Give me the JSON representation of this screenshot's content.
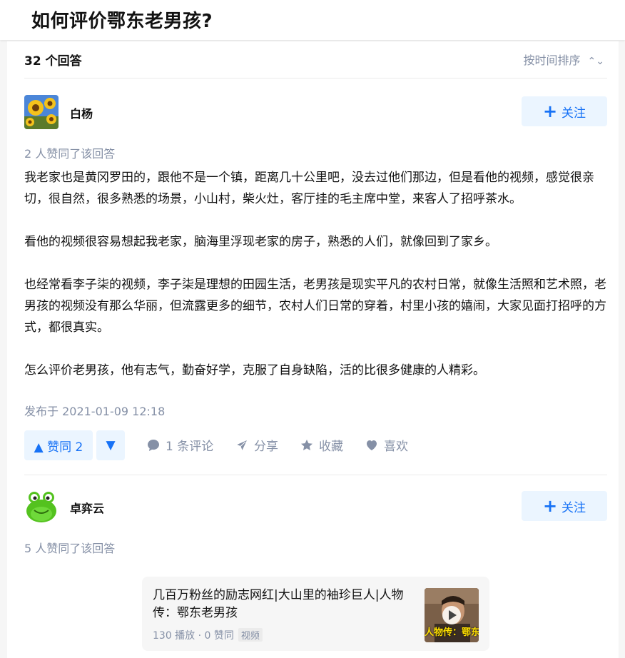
{
  "question": {
    "title": "如何评价鄂东老男孩?"
  },
  "answers_header": {
    "count_label": "32 个回答",
    "sort_label": "按时间排序"
  },
  "answer1": {
    "author": "白杨",
    "follow_label": "关注",
    "upvote_info": "2 人赞同了该回答",
    "paragraphs": [
      "我老家也是黄冈罗田的，跟他不是一个镇，距离几十公里吧，没去过他们那边，但是看他的视频，感觉很亲切，很自然，很多熟悉的场景，小山村，柴火灶，客厅挂的毛主席中堂，来客人了招呼茶水。",
      "看他的视频很容易想起我老家，脑海里浮现老家的房子，熟悉的人们，就像回到了家乡。",
      "也经常看李子柒的视频，李子柒是理想的田园生活，老男孩是现实平凡的农村日常，就像生活照和艺术照，老男孩的视频没有那么华丽，但流露更多的细节，农村人们日常的穿着，村里小孩的嬉闹，大家见面打招呼的方式，都很真实。",
      "怎么评价老男孩，他有志气，勤奋好学，克服了自身缺陷，活的比很多健康的人精彩。"
    ],
    "publish_time": "发布于 2021-01-09 12:18",
    "actions": {
      "upvote_label": "▲ 赞同 2",
      "downvote_label": "▼",
      "comment_label": "1 条评论",
      "share_label": "分享",
      "favorite_label": "收藏",
      "like_label": "喜欢"
    }
  },
  "answer2": {
    "author": "卓弈云",
    "follow_label": "关注",
    "upvote_info": "5 人赞同了该回答",
    "video": {
      "title": "几百万粉丝的励志网红|大山里的袖珍巨人|人物传：鄂东老男孩",
      "meta": "130 播放 · 0 赞同",
      "tag": "视频",
      "thumb_caption": "人物传：鄂东老"
    }
  },
  "colors": {
    "accent": "#1772f6",
    "accent_bg": "#ebf5ff",
    "muted": "#8590a6"
  }
}
